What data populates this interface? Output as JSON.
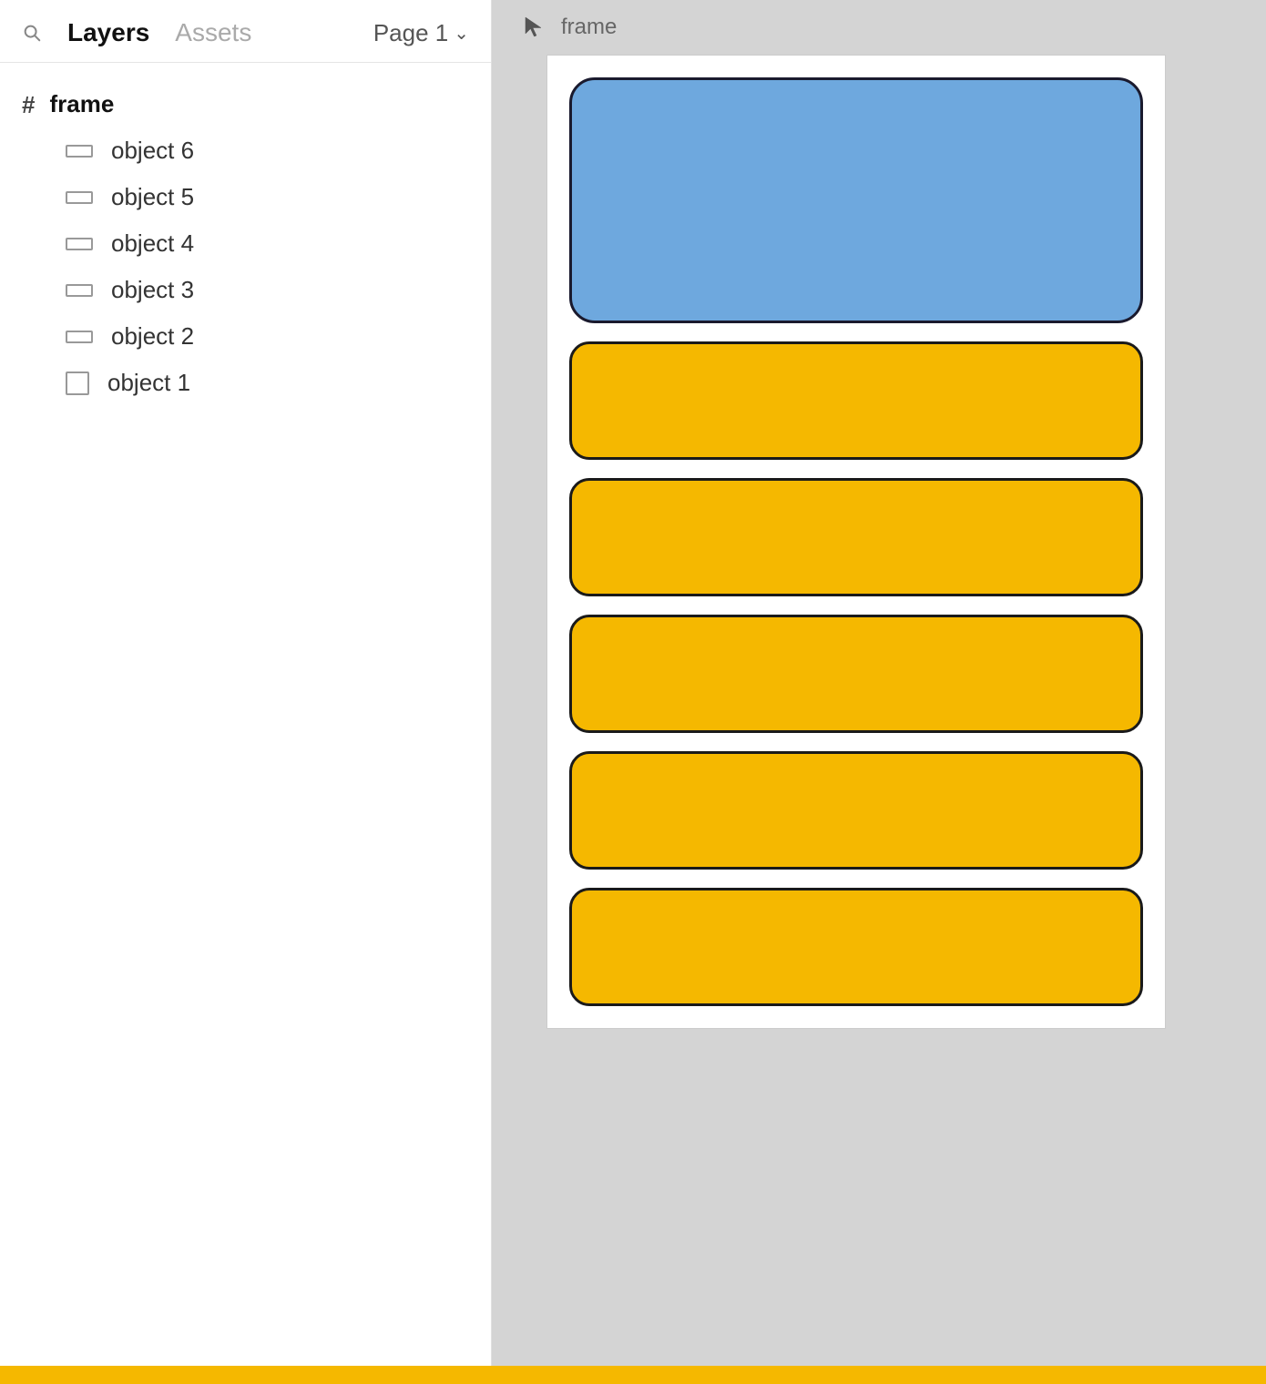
{
  "header": {
    "layers_label": "Layers",
    "assets_label": "Assets",
    "page_label": "Page 1"
  },
  "layers": {
    "frame_label": "frame",
    "items": [
      {
        "id": "object6",
        "label": "object 6",
        "icon_type": "thin"
      },
      {
        "id": "object5",
        "label": "object 5",
        "icon_type": "thin"
      },
      {
        "id": "object4",
        "label": "object 4",
        "icon_type": "thin"
      },
      {
        "id": "object3",
        "label": "object 3",
        "icon_type": "thin"
      },
      {
        "id": "object2",
        "label": "object 2",
        "icon_type": "thin"
      },
      {
        "id": "object1",
        "label": "object 1",
        "icon_type": "square"
      }
    ]
  },
  "canvas": {
    "frame_title": "frame",
    "objects": [
      {
        "id": "obj6",
        "type": "blue"
      },
      {
        "id": "obj5",
        "type": "yellow"
      },
      {
        "id": "obj4",
        "type": "yellow"
      },
      {
        "id": "obj3",
        "type": "yellow"
      },
      {
        "id": "obj2",
        "type": "yellow"
      },
      {
        "id": "obj1",
        "type": "yellow"
      }
    ]
  },
  "colors": {
    "blue_fill": "#6ea8de",
    "yellow_fill": "#f5b800",
    "stroke": "#1a1a1a"
  }
}
